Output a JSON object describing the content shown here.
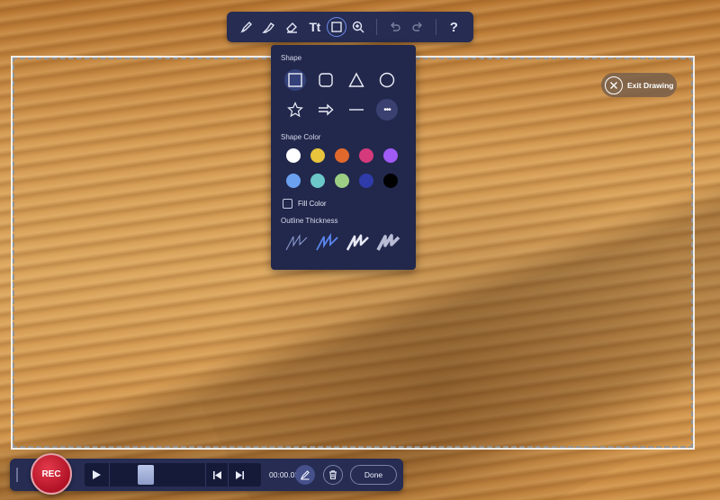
{
  "toolbar": {
    "tools": [
      {
        "icon": "pen-icon"
      },
      {
        "icon": "highlighter-icon"
      },
      {
        "icon": "eraser-icon"
      },
      {
        "icon": "text-tool-icon",
        "label": "Tt"
      },
      {
        "icon": "shape-tool-icon",
        "active": true
      },
      {
        "icon": "zoom-icon"
      }
    ],
    "undo_icon": "undo-icon",
    "redo_icon": "redo-icon",
    "help_label": "?"
  },
  "shape_panel": {
    "shape_label": "Shape",
    "shapes": [
      "rectangle-icon",
      "rounded-rectangle-icon",
      "triangle-icon",
      "circle-icon",
      "star-icon",
      "arrow-icon",
      "line-icon",
      "more-icon"
    ],
    "selected_shape": "rectangle-icon",
    "more_label": "•••",
    "shape_color_label": "Shape Color",
    "colors": [
      "#ffffff",
      "#e8c33c",
      "#e0682c",
      "#d43a7c",
      "#a05af5",
      "#6aa0ee",
      "#6cc8c8",
      "#9ccf84",
      "#2f3ba8",
      "#000000"
    ],
    "fill_color_label": "Fill Color",
    "fill_color_checked": false,
    "outline_thickness_label": "Outline Thickness",
    "thickness_options": 4,
    "selected_thickness": 2
  },
  "exit_drawing": {
    "label": "Exit Drawing"
  },
  "recorder": {
    "rec_label": "REC",
    "time": "00:00.05",
    "done_label": "Done",
    "progress": 0.35
  },
  "colors": {
    "panel_bg": "#22284c",
    "toolbar_bg": "#262c52",
    "accent": "#6d8ff0",
    "rec_red": "#c8192e"
  }
}
